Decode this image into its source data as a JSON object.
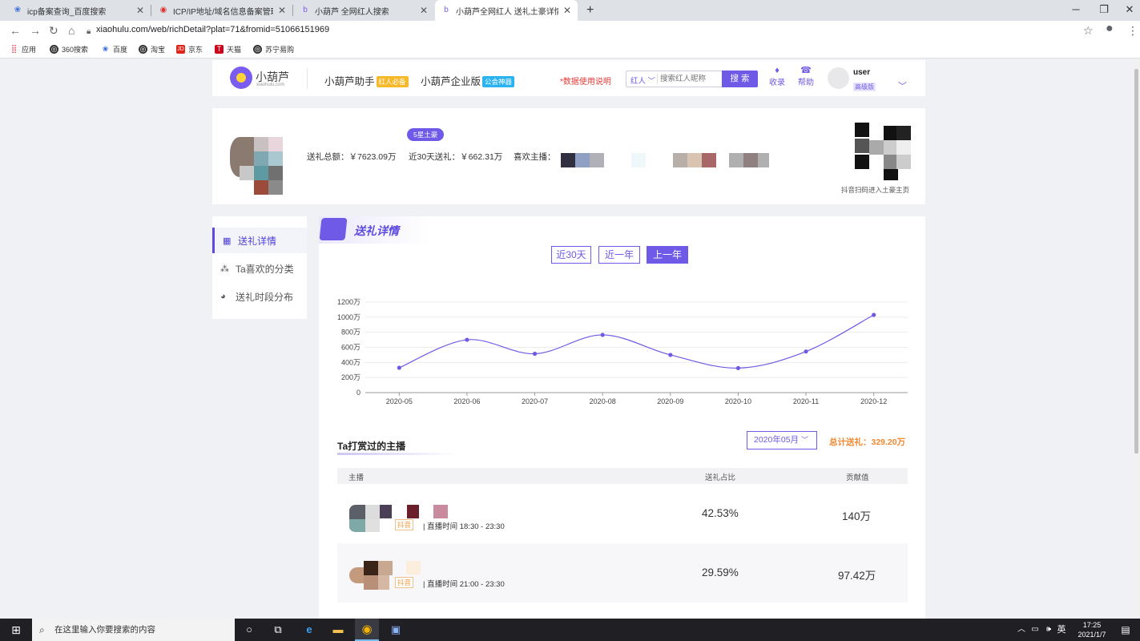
{
  "browser": {
    "tabs": [
      {
        "title": "icp备案查询_百度搜索",
        "icon": "baidu-paw-icon"
      },
      {
        "title": "ICP/IP地址/域名信息备案管理系",
        "icon": "gov-icon"
      },
      {
        "title": "小葫芦 全网红人搜索",
        "icon": "xiaohulu-icon"
      },
      {
        "title": "小葫芦全网红人 送礼土豪详情",
        "icon": "xiaohulu-icon"
      }
    ],
    "url": "xiaohulu.com/web/richDetail?plat=71&fromid=51066151969",
    "bookmarks": [
      "应用",
      "360搜索",
      "百度",
      "淘宝",
      "京东",
      "天猫",
      "苏宁易购"
    ]
  },
  "header": {
    "logo_text": "小葫芦",
    "logo_sub": "xiaohulu.com",
    "nav1": "小葫芦助手",
    "nav1_badge": "红人必备",
    "nav2": "小葫芦企业版",
    "nav2_badge": "公会神器",
    "data_notice": "*数据使用说明",
    "search_type": "红人",
    "search_placeholder": "搜索红人昵称",
    "search_button": "搜 索",
    "favorite": "收录",
    "help": "帮助",
    "username": "user",
    "user_level": "高级版"
  },
  "profile": {
    "level_badge": "5星土豪",
    "total_gift": "送礼总额：￥7623.09万",
    "recent_gift": "近30天送礼：￥662.31万",
    "fav_anchor_label": "喜欢主播：",
    "qr_caption": "抖音扫码进入土豪主页"
  },
  "sidebar": {
    "items": [
      {
        "label": "送礼详情",
        "icon": "gift-icon"
      },
      {
        "label": "Ta喜欢的分类",
        "icon": "category-icon"
      },
      {
        "label": "送礼时段分布",
        "icon": "clock-icon"
      }
    ]
  },
  "main": {
    "section_title": "送礼详情",
    "periods": [
      "近30天",
      "近一年",
      "上一年"
    ],
    "active_period": 2,
    "anchors_title": "Ta打赏过的主播",
    "month_select": "2020年05月",
    "total_label": "总计送礼：329.20万",
    "columns": [
      "主播",
      "送礼占比",
      "贡献值"
    ],
    "rows": [
      {
        "platform": "抖音",
        "live_time": "直播时间 18:30 - 23:30",
        "pct": "42.53%",
        "value": "140万"
      },
      {
        "platform": "抖音",
        "live_time": "直播时间 21:00 - 23:30",
        "pct": "29.59%",
        "value": "97.42万"
      }
    ]
  },
  "chart_data": {
    "type": "line",
    "categories": [
      "2020-05",
      "2020-06",
      "2020-07",
      "2020-08",
      "2020-09",
      "2020-10",
      "2020-11",
      "2020-12"
    ],
    "series": [
      {
        "values": [
          329,
          700,
          515,
          765,
          500,
          325,
          545,
          1030
        ]
      }
    ],
    "y_ticks": [
      "0",
      "200万",
      "400万",
      "600万",
      "800万",
      "1000万",
      "1200万"
    ],
    "ylim": [
      0,
      1200
    ],
    "color": "#6e5ae6",
    "grid": true
  },
  "taskbar": {
    "search_placeholder": "在这里输入你要搜索的内容",
    "ime": "英",
    "time": "17:25",
    "date": "2021/1/7"
  }
}
